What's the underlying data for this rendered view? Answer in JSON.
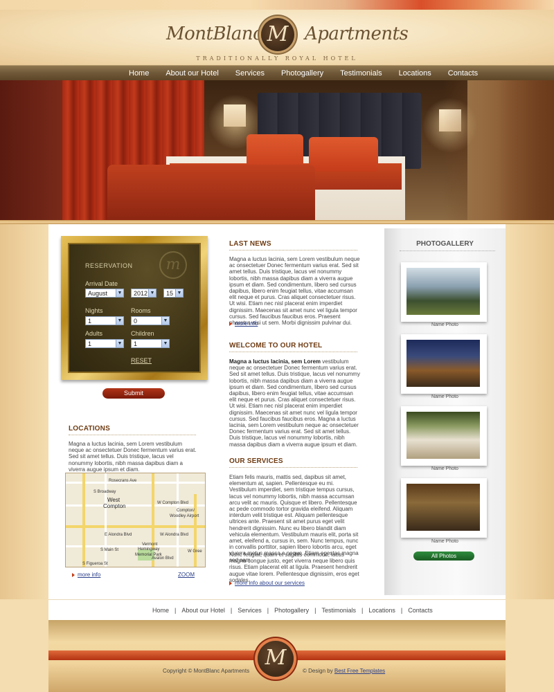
{
  "brand": {
    "name_left": "MontBlanc",
    "name_right": "Apartments",
    "mark": "M",
    "tagline": "TRADITIONALLY ROYAL HOTEL"
  },
  "nav": [
    "Home",
    "About our Hotel",
    "Services",
    "Photogallery",
    "Testimonials",
    "Locations",
    "Contacts"
  ],
  "reservation": {
    "title": "RESERVATION",
    "arrival_label": "Arrival Date",
    "month": "August",
    "year": "2012",
    "day": "15",
    "nights_label": "Nights",
    "nights": "1",
    "rooms_label": "Rooms",
    "rooms": "0",
    "adults_label": "Adults",
    "adults": "1",
    "children_label": "Children",
    "children": "1",
    "reset": "RESET",
    "submit": "Submit"
  },
  "locations": {
    "title": "LOCATIONS",
    "text": "Magna a luctus lacinia, sem Lorem vestibulum neque ac onsectetuer Donec fermentum varius erat. Sed sit amet tellus. Duis tristique, lacus vel nonummy lobortis, nibh massa dapibus diam a viverra augue ipsum et diam.",
    "more": "more info",
    "zoom": "ZOOM",
    "map_labels": {
      "rosecrans": "Rosecrans Ave",
      "west_compton": "West",
      "west_compton2": "Compton",
      "compton_blvd": "W Compton Blvd",
      "compton_airport": "Compton/",
      "compton_airport2": "Woodley Airport",
      "alondra": "E Alondra Blvd",
      "alondra2": "W Alondra Blvd",
      "vermont": "Vermont",
      "hemingway": "Hemingway",
      "memorial": "Memorial Park",
      "figueroa": "S Figueroa St",
      "broadway": "S Broadway",
      "main": "S Main St",
      "avalon": "Avalon Blvd",
      "greenleaf": "W Gree"
    }
  },
  "news": {
    "title": "LAST NEWS",
    "text": "Magna a luctus lacinia, sem Lorem vestibulum neque ac onsectetuer Donec fermentum varius erat. Sed sit amet tellus. Duis tristique, lacus vel nonummy lobortis, nibh massa dapibus diam a viverra augue ipsum et diam. Sed condimentum, libero sed cursus dapibus, libero enim feugiat tellus, vitae accumsan elit neque et purus. Cras aliquet consectetuer risus. Ut wisi. Etiam nec nisl placerat enim imperdiet dignissim. Maecenas sit amet nunc vel ligula tempor cursus. Sed faucibus faucibus eros. Praesent pharetra wisi ut sem. Morbi dignissim pulvinar dui.",
    "more": "more info"
  },
  "welcome": {
    "title": "WELCOME TO OUR HOTEL",
    "lead": "Magna a luctus lacinia, sem Lorem",
    "text": " vestibulum neque ac onsectetuer Donec fermentum varius erat. Sed sit amet tellus. Duis tristique, lacus vel nonummy lobortis, nibh massa dapibus diam a viverra augue ipsum et diam. Sed condimentum, libero sed cursus dapibus, libero enim feugiat tellus, vitae accumsan elit neque et purus. Cras aliquet consectetuer risus. Ut wisi. Etiam nec nisl placerat enim imperdiet dignissim. Maecenas sit amet nunc vel ligula tempor cursus. Sed faucibus faucibus eros. Magna a luctus lacinia, sem Lorem vestibulum neque ac onsectetuer Donec fermentum varius erat. Sed sit amet tellus. Duis tristique, lacus vel nonummy lobortis, nibh massa dapibus diam a viverra augue ipsum et diam."
  },
  "services": {
    "title": "OUR SERVICES",
    "text1": "Etiam felis mauris, mattis sed, dapibus sit amet, elementum at, sapien. Pellentesque eu mi. Vestibulum imperdiet, sem tristique tempus cursus, lacus vel nonummy lobortis, nibh massa accumsan arcu velit ac mauris. Quisque et libero. Pellentesque ac pede commodo tortor gravida eleifend. Aliquam interdum velit tristique est. Aliquam pellentesque ultrices ante. Praesent sit amet purus eget velit hendrerit dignissim. Nunc eu libero blandit diam vehicula elementum. Vestibulum mauris elit, porta sit amet, eleifend a, cursus in, sem. Nunc tempus, nunc in convallis porttitor, sapien libero lobortis arcu, eget viverra metus massa a neque. Etiam egestas magna sed sem.",
    "text2": "Nunc feugiat, quam et sagittis commodo, lacus magna congue justo, eget viverra neque libero quis risus. Etiam placerat elit at ligula. Praesent hendrerit augue vitae lorem. Pellentesque dignissim, eros eget sodales.",
    "more": "more info about our services"
  },
  "gallery": {
    "title": "PHOTOGALLERY",
    "captions": [
      "Name Photo",
      "Name Photo",
      "Name Photo",
      "Name Photo"
    ],
    "all": "All Photos"
  },
  "footer": {
    "nav": [
      "Home",
      "About our Hotel",
      "Services",
      "Photogallery",
      "Testimonials",
      "Locations",
      "Contacts"
    ],
    "copyright": "Copyright © MontBlanc Apartments",
    "design_prefix": "© Design by ",
    "design_link": "Best Free Templates"
  },
  "colors": {
    "accent": "#6e3b12",
    "link": "#2a3f8a",
    "submit": "#9a2a12",
    "gallery_button": "#2e8c3c"
  }
}
